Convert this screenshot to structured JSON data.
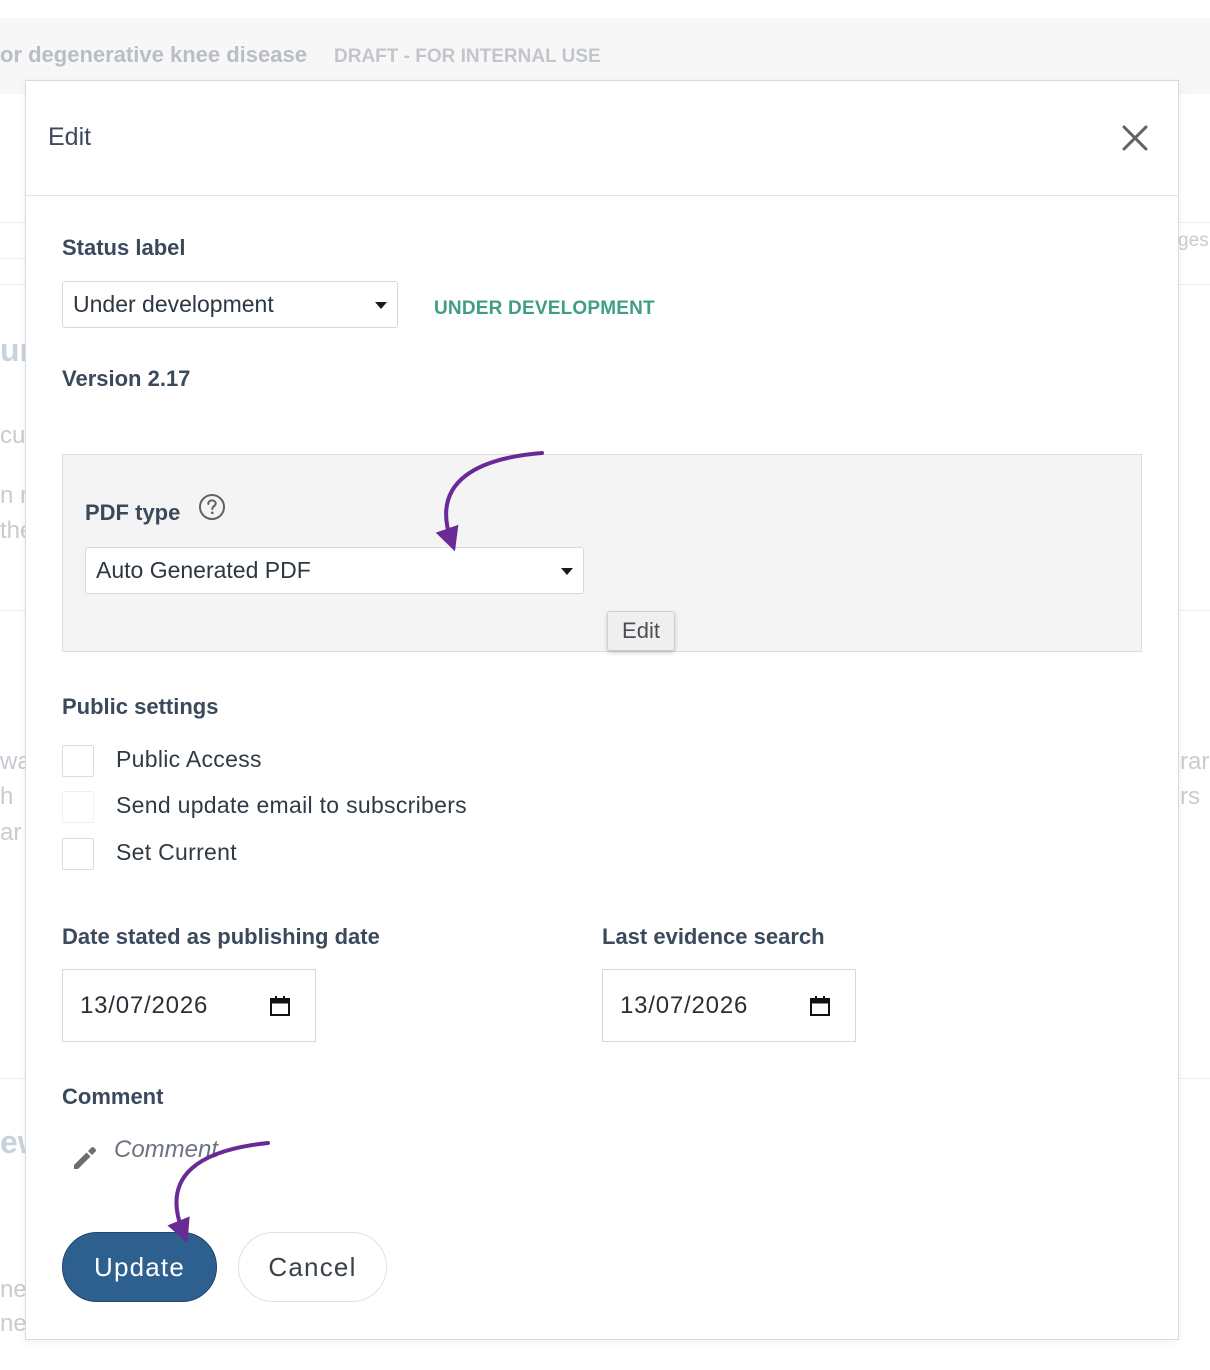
{
  "background": {
    "page_title": "or degenerative knee disease",
    "draft_badge": "DRAFT - FOR INTERNAL USE",
    "fragments_left": [
      "un",
      "cu",
      "n r",
      "the",
      "wa",
      "h",
      "ar",
      "ew",
      "ner",
      "ner"
    ],
    "fragments_right": [
      "ges",
      "rar",
      "rs"
    ]
  },
  "modal": {
    "title": "Edit",
    "close_icon": "close-icon",
    "status": {
      "label": "Status label",
      "selected": "Under development",
      "tag": "UNDER DEVELOPMENT",
      "tag_color": "#3f9e85"
    },
    "version": "Version 2.17",
    "pdf": {
      "label": "PDF type",
      "help_icon": "help-icon",
      "selected": "Auto Generated PDF",
      "edit_label": "Edit"
    },
    "public_settings": {
      "label": "Public settings",
      "options": [
        {
          "label": "Public Access",
          "checked": false
        },
        {
          "label": "Send update email to subscribers",
          "checked": false
        },
        {
          "label": "Set Current",
          "checked": false
        }
      ]
    },
    "dates": {
      "publishing_label": "Date stated as publishing date",
      "publishing_value": "13/07/2026",
      "evidence_label": "Last evidence search",
      "evidence_value": "13/07/2026"
    },
    "comment": {
      "label": "Comment",
      "placeholder": "Comment"
    },
    "buttons": {
      "update": "Update",
      "cancel": "Cancel"
    },
    "colors": {
      "primary": "#2d5f8f",
      "annotation_arrow": "#6a2a96"
    }
  }
}
